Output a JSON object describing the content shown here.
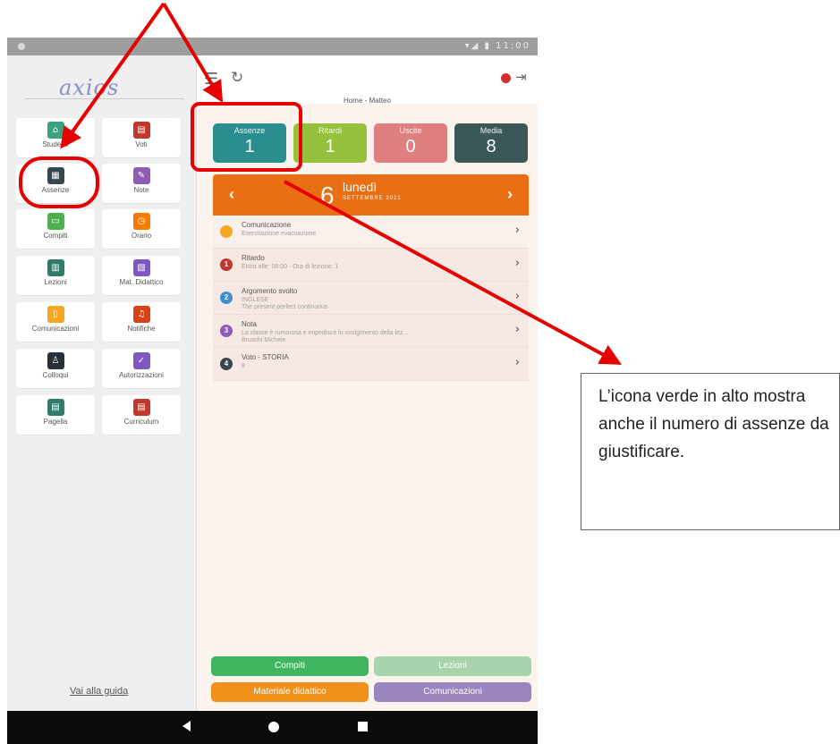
{
  "status_bar": {
    "icons": "▾◢ ▮ 11:00"
  },
  "sidebar": {
    "logo": "axios",
    "menu": [
      {
        "label": "Studenti",
        "icon": "house-icon",
        "color": "#3aa17e",
        "glyph": "⌂"
      },
      {
        "label": "Voti",
        "icon": "clipboard-icon",
        "color": "#c0392b",
        "glyph": "▤"
      },
      {
        "label": "Assenze",
        "icon": "calendar-icon",
        "color": "#37474f",
        "glyph": "▦"
      },
      {
        "label": "Note",
        "icon": "note-icon",
        "color": "#8e5bb5",
        "glyph": "✎"
      },
      {
        "label": "Compiti",
        "icon": "laptop-icon",
        "color": "#4caf50",
        "glyph": "▭"
      },
      {
        "label": "Orario",
        "icon": "clock-icon",
        "color": "#f57c00",
        "glyph": "◷"
      },
      {
        "label": "Lezioni",
        "icon": "board-icon",
        "color": "#2e7d6b",
        "glyph": "▥"
      },
      {
        "label": "Mat. Didattico",
        "icon": "books-icon",
        "color": "#7e57c2",
        "glyph": "▧"
      },
      {
        "label": "Comunicazioni",
        "icon": "document-icon",
        "color": "#f5a623",
        "glyph": "▯"
      },
      {
        "label": "Notifiche",
        "icon": "bell-icon",
        "color": "#d84315",
        "glyph": "♫"
      },
      {
        "label": "Colloqui",
        "icon": "people-icon",
        "color": "#263238",
        "glyph": "♙"
      },
      {
        "label": "Autorizzazioni",
        "icon": "authorization-icon",
        "color": "#7e57c2",
        "glyph": "✓"
      },
      {
        "label": "Pagella",
        "icon": "report-card-icon",
        "color": "#2e7d6b",
        "glyph": "▤"
      },
      {
        "label": "Curriculum",
        "icon": "curriculum-icon",
        "color": "#c0392b",
        "glyph": "▤"
      }
    ],
    "guide_link": "Vai alla guida"
  },
  "header": {
    "breadcrumb": "Home - Matteo"
  },
  "stats": [
    {
      "label": "Assenze",
      "value": "1",
      "color": "#2a8e8e"
    },
    {
      "label": "Ritardi",
      "value": "1",
      "color": "#95c13c"
    },
    {
      "label": "Uscite",
      "value": "0",
      "color": "#e07f7f"
    },
    {
      "label": "Media",
      "value": "8",
      "color": "#3a5858"
    }
  ],
  "date": {
    "day": "6",
    "weekday": "lunedì",
    "month": "SETTEMBRE 2021",
    "prev": "‹",
    "next": "›"
  },
  "events": [
    {
      "badge": "",
      "badge_color": "#f5a623",
      "title": "Comunicazione",
      "sub": "Esercitazione evacuazione",
      "sub2": ""
    },
    {
      "badge": "1",
      "badge_color": "#c0392b",
      "title": "Ritardo",
      "sub": "Entra alle: 08:00 · Ora di lezione: 1",
      "sub2": ""
    },
    {
      "badge": "2",
      "badge_color": "#3d8fd1",
      "title": "Argomento svolto",
      "sub": "INGLESE",
      "sub2": "The present perfect continuous"
    },
    {
      "badge": "3",
      "badge_color": "#8e5bb5",
      "title": "Nota",
      "sub": "La classe è rumorosa e impedisce lo svolgimento della lez...",
      "sub2": "Bruschi Michele"
    },
    {
      "badge": "4",
      "badge_color": "#37474f",
      "title": "Voto - STORIA",
      "sub": "8",
      "sub2": ""
    }
  ],
  "bottom_buttons": [
    {
      "label": "Compiti",
      "color": "#3eb55f"
    },
    {
      "label": "Lezioni",
      "color": "#a8d4ab"
    },
    {
      "label": "Materiale didattico",
      "color": "#f0911c"
    },
    {
      "label": "Comunicazioni",
      "color": "#9a85bd"
    }
  ],
  "annotation": {
    "text": "L’icona verde in alto mostra anche il numero di assenze da giustificare.",
    "color": "#e60000"
  }
}
